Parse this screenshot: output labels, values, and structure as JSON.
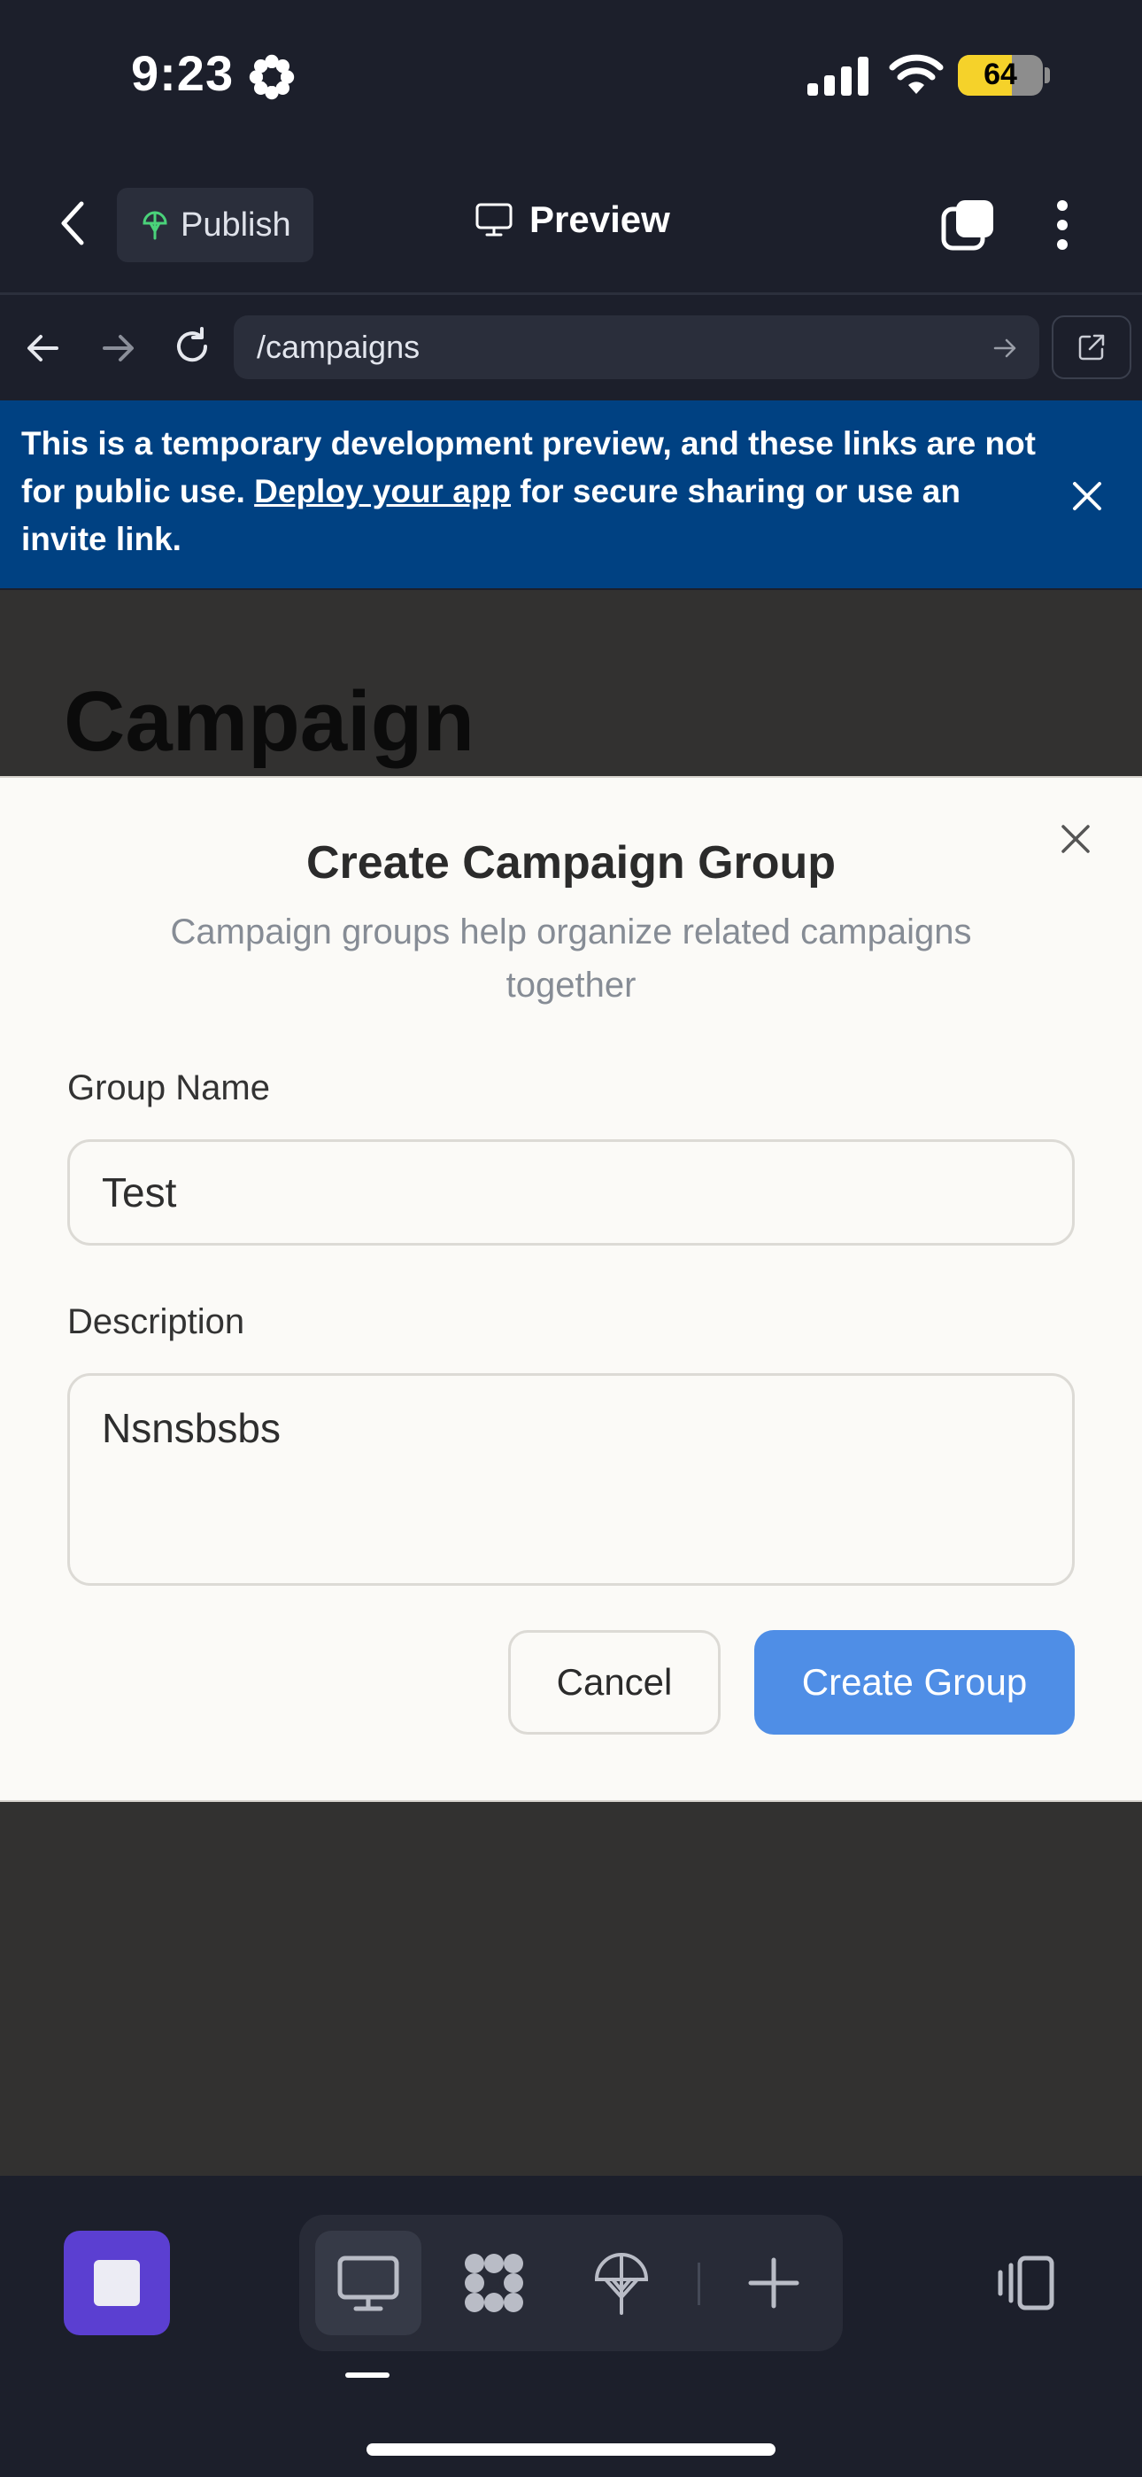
{
  "status_bar": {
    "time": "9:23",
    "battery": "64",
    "battery_level": 0.64
  },
  "toolbar": {
    "publish_label": "Publish",
    "preview_label": "Preview"
  },
  "browser": {
    "url": "/campaigns"
  },
  "banner": {
    "text_before": "This is a temporary development preview, and these links are not for public use. ",
    "link_text": "Deploy your app",
    "text_after": " for secure sharing or use an invite link."
  },
  "page": {
    "heading": "Campaign"
  },
  "dialog": {
    "title": "Create Campaign Group",
    "description": "Campaign groups help organize related campaigns together",
    "group_name_label": "Group Name",
    "group_name_value": "Test",
    "description_label": "Description",
    "description_value": "Nsnsbsbs",
    "cancel_label": "Cancel",
    "create_label": "Create Group"
  },
  "colors": {
    "accent": "#4f8ee6",
    "banner": "#004182",
    "stop_button": "#5b3fd1",
    "chrome": "#1c1f2b"
  },
  "icons": [
    "gear-icon",
    "signal-icon",
    "wifi-icon",
    "battery-icon",
    "back-chevron-icon",
    "publish-icon",
    "monitor-icon",
    "tabs-icon",
    "more-icon",
    "nav-back-icon",
    "nav-forward-icon",
    "reload-icon",
    "go-arrow-icon",
    "external-link-icon",
    "close-icon",
    "stop-icon",
    "desktop-icon",
    "apps-icon",
    "deploy-icon",
    "plus-icon",
    "device-frame-icon"
  ]
}
